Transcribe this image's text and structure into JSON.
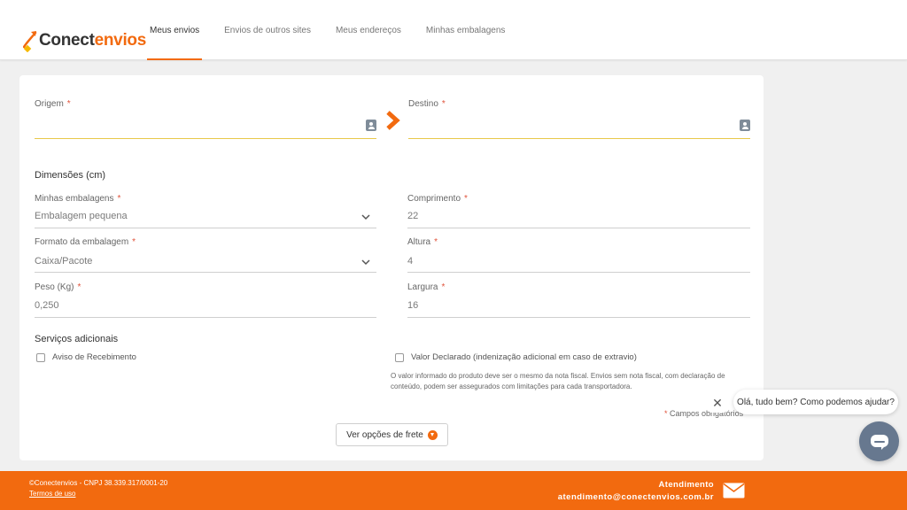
{
  "brand": {
    "part1": "Conect",
    "part2": "envios",
    "accent": "#f26a0f"
  },
  "nav": [
    "Meus envios",
    "Envios de outros sites",
    "Meus endereços",
    "Minhas embalagens"
  ],
  "form": {
    "origin_label": "Origem",
    "destination_label": "Destino",
    "required_mark": "*",
    "dimensions_title": "Dimensões (cm)",
    "packages_label": "Minhas embalagens",
    "packages_value": "Embalagem pequena",
    "format_label": "Formato da embalagem",
    "format_value": "Caixa/Pacote",
    "weight_label": "Peso (Kg)",
    "weight_value": "0,250",
    "length_label": "Comprimento",
    "length_value": "22",
    "height_label": "Altura",
    "height_value": "4",
    "width_label": "Largura",
    "width_value": "16",
    "services_title": "Serviços adicionais",
    "receipt_label": "Aviso de Recebimento",
    "declared_label": "Valor Declarado (indenização adicional em caso de extravio)",
    "declared_note": "O valor informado do produto deve ser o mesmo da nota fiscal. Envios sem nota fiscal, com declaração de conteúdo, podem ser assegurados com limitações para cada transportadora.",
    "required_note": "Campos obrigatórios",
    "freight_button": "Ver opções de frete"
  },
  "chat": {
    "close_symbol": "✕",
    "message": "Olá, tudo bem? Como podemos ajudar?"
  },
  "footer": {
    "copyright": "©Conectenvios - CNPJ 38.339.317/0001-20",
    "terms": "Termos de uso",
    "support_title": "Atendimento",
    "support_email": "atendimento@conectenvios.com.br"
  }
}
